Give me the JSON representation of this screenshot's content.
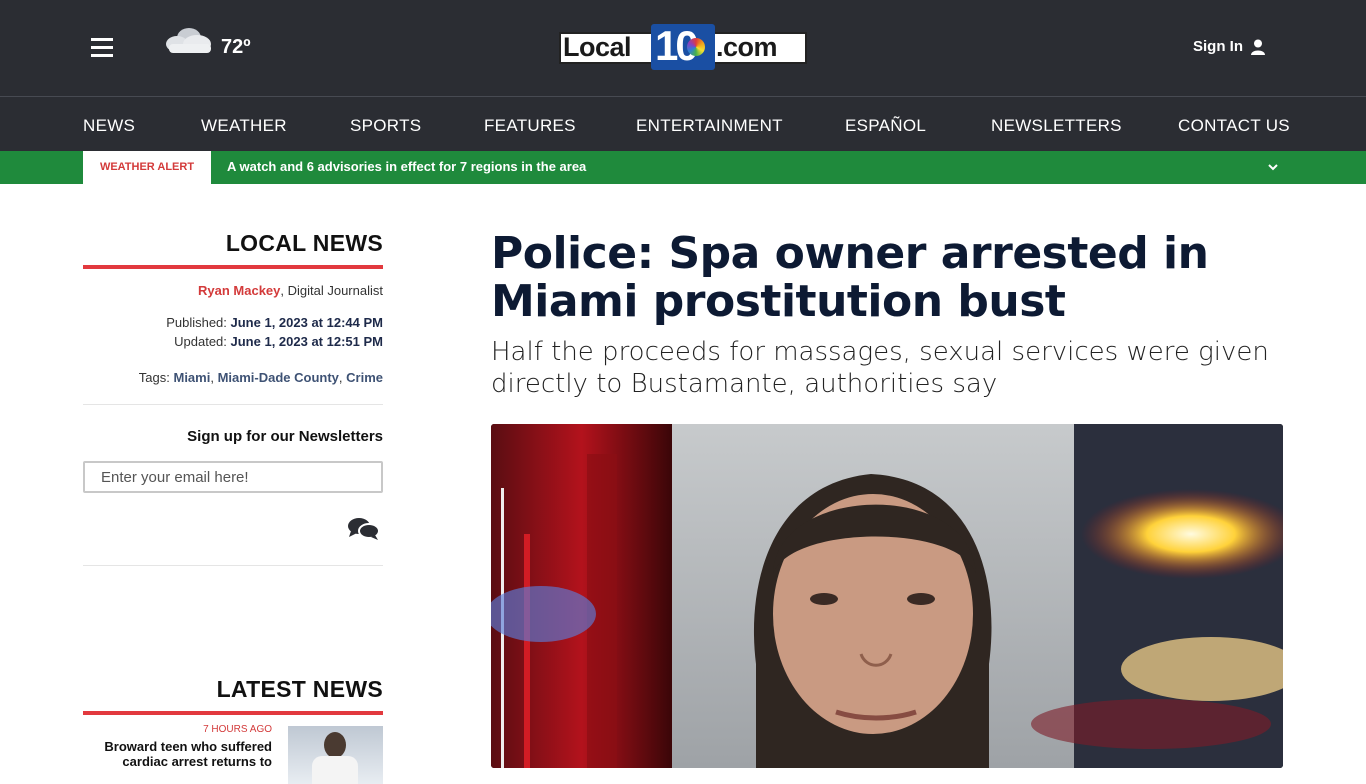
{
  "header": {
    "temperature": "72º",
    "logo_left": "Local",
    "logo_ten": "10",
    "logo_right": ".com",
    "signin_label": "Sign In"
  },
  "nav": {
    "items": [
      "NEWS",
      "WEATHER",
      "SPORTS",
      "FEATURES",
      "ENTERTAINMENT",
      "ESPAÑOL",
      "NEWSLETTERS",
      "CONTACT US"
    ]
  },
  "alert": {
    "tag": "WEATHER ALERT",
    "text": "A watch and 6 advisories in effect for 7 regions in the area"
  },
  "sidebar": {
    "section_title": "LOCAL NEWS",
    "author_name": "Ryan Mackey",
    "author_role": ", Digital Journalist",
    "published_label": "Published: ",
    "published_value": "June 1, 2023 at 12:44 PM",
    "updated_label": "Updated: ",
    "updated_value": "June 1, 2023 at 12:51 PM",
    "tags_label": "Tags: ",
    "tags": [
      "Miami",
      "Miami-Dade County",
      "Crime"
    ],
    "newsletter_title": "Sign up for our Newsletters",
    "email_placeholder": "Enter your email here!",
    "latest_title": "LATEST NEWS",
    "latest_time": "7 HOURS AGO",
    "latest_headline_1": "Broward teen who suffered",
    "latest_headline_2": "cardiac arrest returns to"
  },
  "article": {
    "headline": "Police: Spa owner arrested in Miami prostitution bust",
    "subheadline": "Half the proceeds for massages, sexual services were given directly to Bustamante, authorities say"
  },
  "colors": {
    "header_bg": "#2b2d33",
    "alert_green": "#1f8a3c",
    "accent_red": "#e2393e",
    "headline_navy": "#0d1a33"
  }
}
